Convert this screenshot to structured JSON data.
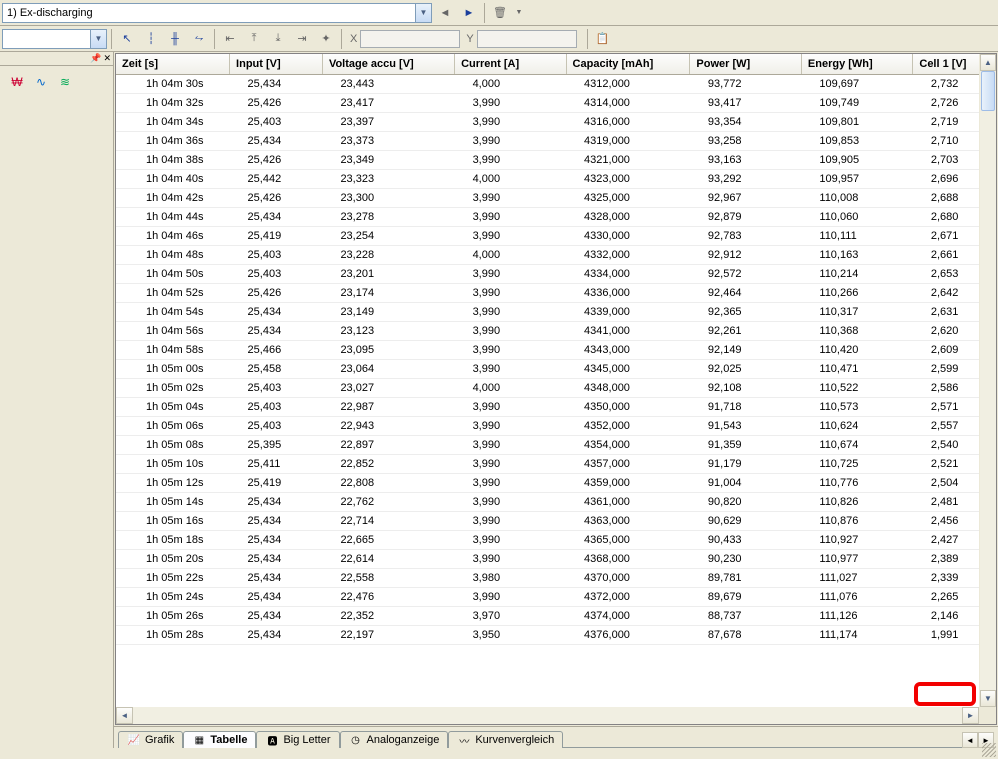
{
  "toolbar1": {
    "main_dropdown": "1) Ex-discharging",
    "trash_icon": "trash"
  },
  "toolbar2": {
    "small_dropdown": "",
    "coord_x_label": "X",
    "coord_y_label": "Y"
  },
  "sidebar": {},
  "table": {
    "headers": [
      "Zeit [s]",
      "Input [V]",
      "Voltage accu [V]",
      "Current [A]",
      "Capacity [mAh]",
      "Power [W]",
      "Energy [Wh]",
      "Cell 1 [V]"
    ],
    "rows": [
      [
        "1h 04m 30s",
        "25,434",
        "23,443",
        "4,000",
        "4312,000",
        "93,772",
        "109,697",
        "2,732"
      ],
      [
        "1h 04m 32s",
        "25,426",
        "23,417",
        "3,990",
        "4314,000",
        "93,417",
        "109,749",
        "2,726"
      ],
      [
        "1h 04m 34s",
        "25,403",
        "23,397",
        "3,990",
        "4316,000",
        "93,354",
        "109,801",
        "2,719"
      ],
      [
        "1h 04m 36s",
        "25,434",
        "23,373",
        "3,990",
        "4319,000",
        "93,258",
        "109,853",
        "2,710"
      ],
      [
        "1h 04m 38s",
        "25,426",
        "23,349",
        "3,990",
        "4321,000",
        "93,163",
        "109,905",
        "2,703"
      ],
      [
        "1h 04m 40s",
        "25,442",
        "23,323",
        "4,000",
        "4323,000",
        "93,292",
        "109,957",
        "2,696"
      ],
      [
        "1h 04m 42s",
        "25,426",
        "23,300",
        "3,990",
        "4325,000",
        "92,967",
        "110,008",
        "2,688"
      ],
      [
        "1h 04m 44s",
        "25,434",
        "23,278",
        "3,990",
        "4328,000",
        "92,879",
        "110,060",
        "2,680"
      ],
      [
        "1h 04m 46s",
        "25,419",
        "23,254",
        "3,990",
        "4330,000",
        "92,783",
        "110,111",
        "2,671"
      ],
      [
        "1h 04m 48s",
        "25,403",
        "23,228",
        "4,000",
        "4332,000",
        "92,912",
        "110,163",
        "2,661"
      ],
      [
        "1h 04m 50s",
        "25,403",
        "23,201",
        "3,990",
        "4334,000",
        "92,572",
        "110,214",
        "2,653"
      ],
      [
        "1h 04m 52s",
        "25,426",
        "23,174",
        "3,990",
        "4336,000",
        "92,464",
        "110,266",
        "2,642"
      ],
      [
        "1h 04m 54s",
        "25,434",
        "23,149",
        "3,990",
        "4339,000",
        "92,365",
        "110,317",
        "2,631"
      ],
      [
        "1h 04m 56s",
        "25,434",
        "23,123",
        "3,990",
        "4341,000",
        "92,261",
        "110,368",
        "2,620"
      ],
      [
        "1h 04m 58s",
        "25,466",
        "23,095",
        "3,990",
        "4343,000",
        "92,149",
        "110,420",
        "2,609"
      ],
      [
        "1h 05m 00s",
        "25,458",
        "23,064",
        "3,990",
        "4345,000",
        "92,025",
        "110,471",
        "2,599"
      ],
      [
        "1h 05m 02s",
        "25,403",
        "23,027",
        "4,000",
        "4348,000",
        "92,108",
        "110,522",
        "2,586"
      ],
      [
        "1h 05m 04s",
        "25,403",
        "22,987",
        "3,990",
        "4350,000",
        "91,718",
        "110,573",
        "2,571"
      ],
      [
        "1h 05m 06s",
        "25,403",
        "22,943",
        "3,990",
        "4352,000",
        "91,543",
        "110,624",
        "2,557"
      ],
      [
        "1h 05m 08s",
        "25,395",
        "22,897",
        "3,990",
        "4354,000",
        "91,359",
        "110,674",
        "2,540"
      ],
      [
        "1h 05m 10s",
        "25,411",
        "22,852",
        "3,990",
        "4357,000",
        "91,179",
        "110,725",
        "2,521"
      ],
      [
        "1h 05m 12s",
        "25,419",
        "22,808",
        "3,990",
        "4359,000",
        "91,004",
        "110,776",
        "2,504"
      ],
      [
        "1h 05m 14s",
        "25,434",
        "22,762",
        "3,990",
        "4361,000",
        "90,820",
        "110,826",
        "2,481"
      ],
      [
        "1h 05m 16s",
        "25,434",
        "22,714",
        "3,990",
        "4363,000",
        "90,629",
        "110,876",
        "2,456"
      ],
      [
        "1h 05m 18s",
        "25,434",
        "22,665",
        "3,990",
        "4365,000",
        "90,433",
        "110,927",
        "2,427"
      ],
      [
        "1h 05m 20s",
        "25,434",
        "22,614",
        "3,990",
        "4368,000",
        "90,230",
        "110,977",
        "2,389"
      ],
      [
        "1h 05m 22s",
        "25,434",
        "22,558",
        "3,980",
        "4370,000",
        "89,781",
        "111,027",
        "2,339"
      ],
      [
        "1h 05m 24s",
        "25,434",
        "22,476",
        "3,990",
        "4372,000",
        "89,679",
        "111,076",
        "2,265"
      ],
      [
        "1h 05m 26s",
        "25,434",
        "22,352",
        "3,970",
        "4374,000",
        "88,737",
        "111,126",
        "2,146"
      ],
      [
        "1h 05m 28s",
        "25,434",
        "22,197",
        "3,950",
        "4376,000",
        "87,678",
        "111,174",
        "1,991"
      ]
    ]
  },
  "tabs": {
    "items": [
      {
        "label": "Grafik",
        "icon": "chart"
      },
      {
        "label": "Tabelle",
        "icon": "table"
      },
      {
        "label": "Big Letter",
        "icon": "bigletter"
      },
      {
        "label": "Analoganzeige",
        "icon": "gauge"
      },
      {
        "label": "Kurvenvergleich",
        "icon": "compare"
      }
    ],
    "active_index": 1
  }
}
